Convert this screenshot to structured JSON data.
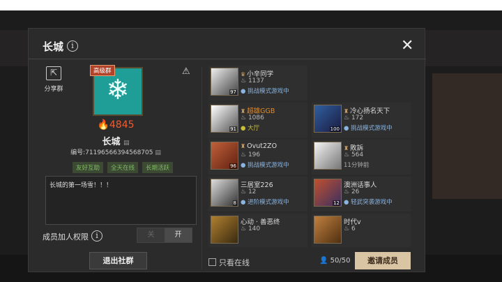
{
  "header": {
    "title": "长城"
  },
  "sidebar": {
    "share_label": "分享群"
  },
  "group": {
    "level_tag": "高级群",
    "heat": "4845",
    "name": "长城",
    "id_text": "编号:71196566394568705",
    "tags": [
      "友好互助",
      "全天在线",
      "长期活跃"
    ],
    "description": "长城的第一场雪！！！",
    "permission_label": "成员加人权限",
    "toggle_off": "关",
    "toggle_on": "开",
    "quit_label": "退出社群"
  },
  "members": [
    {
      "name": "小辛同学",
      "heat": "1137",
      "status": "挑战模式游戏中",
      "level": "97",
      "status_color": "blue"
    },
    {
      "name": "超雄GGB",
      "heat": "1086",
      "status": "大厅",
      "level": "91",
      "status_color": "gold"
    },
    {
      "name": "冷心扬名天下",
      "heat": "172",
      "status": "挑战模式游戏中",
      "level": "100",
      "status_color": "blue"
    },
    {
      "name": "Ovut2ZO",
      "heat": "196",
      "status": "挑战模式游戏中",
      "level": "96",
      "status_color": "blue"
    },
    {
      "name": "敗訴",
      "heat": "564",
      "status": "11分钟前",
      "level": "",
      "status_color": "gray"
    },
    {
      "name": "三居室226",
      "heat": "12",
      "status": "进阶模式游戏中",
      "level": "8",
      "status_color": "blue"
    },
    {
      "name": "澳洲话事人",
      "heat": "26",
      "status": "轻武突袭游戏中",
      "level": "12",
      "status_color": "blue"
    },
    {
      "name": "心动 · 善恶终",
      "heat": "140",
      "status": "",
      "level": "",
      "status_color": "blue"
    },
    {
      "name": "时代v",
      "heat": "6",
      "status": "",
      "level": "",
      "status_color": "blue"
    }
  ],
  "footer": {
    "only_online_label": "只看在线",
    "count": "50/50",
    "invite_label": "邀请成员"
  },
  "colors": {
    "heat": "#ec5d34",
    "accent": "#d9c4a4",
    "avatar_bg": "#1e9e97",
    "status_blue": "#8ab4e0",
    "status_gold": "#c9c03a"
  }
}
